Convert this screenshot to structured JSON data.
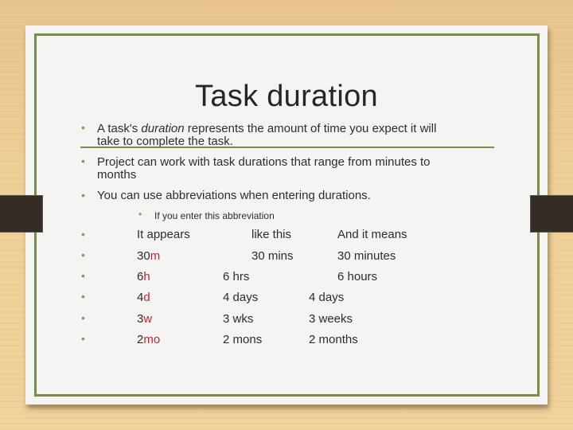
{
  "slide": {
    "title": "Task duration",
    "bullets": [
      {
        "pre": "A task's ",
        "em": "duration",
        "post": " represents the amount of time you expect it will",
        "line2": "take to complete the task."
      },
      {
        "line1": "Project can work with task durations that range from minutes to",
        "line2": "months"
      },
      {
        "line1": "You can use abbreviations when entering durations."
      }
    ],
    "sub_bullet": "If you enter this abbreviation",
    "table": {
      "header": [
        "It appears",
        "like this",
        "And it means"
      ],
      "rows": [
        {
          "num": "30",
          "unit": "m",
          "appears": "30 mins",
          "means": "30 minutes"
        },
        {
          "num": "6",
          "unit": "h",
          "appears": "6 hrs",
          "means": "6 hours"
        },
        {
          "num": "4",
          "unit": "d",
          "appears": "4 days",
          "means": "4 days"
        },
        {
          "num": "3",
          "unit": "w",
          "appears": "3 wks",
          "means": "3 weeks"
        },
        {
          "num": "2",
          "unit": "mo",
          "appears": "2 mons",
          "means": "2 months"
        }
      ]
    },
    "colors": {
      "accent_green": "#7d8c45",
      "abbreviation_red": "#c9252c"
    },
    "bullet_glyph": "•"
  }
}
